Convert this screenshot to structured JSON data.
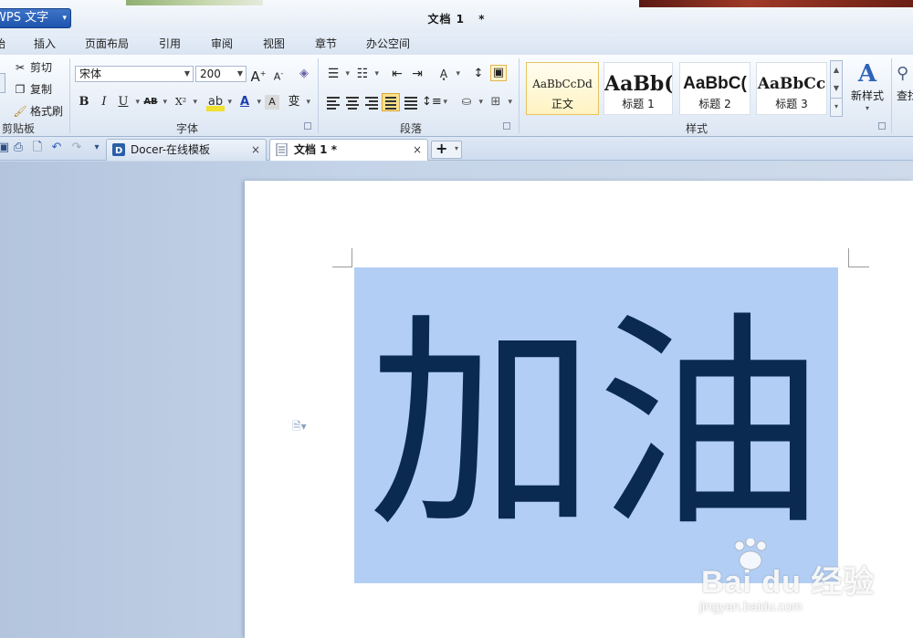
{
  "app": {
    "menu_button": "WPS 文字",
    "menu_arrow": "▾",
    "document_title": "文档 1",
    "modified_marker": "*"
  },
  "ribbon_tabs": [
    "始",
    "插入",
    "页面布局",
    "引用",
    "审阅",
    "视图",
    "章节",
    "办公空间"
  ],
  "clipboard": {
    "group_label": "剪贴板",
    "cut": "剪切",
    "copy": "复制",
    "format_painter": "格式刷"
  },
  "font": {
    "group_label": "字体",
    "font_name": "宋体",
    "font_size": "200",
    "bold": "B",
    "italic": "I",
    "underline": "U",
    "strikethrough": "AB",
    "superscript": "X²",
    "font_color": "A",
    "char_shading": "A",
    "phonetic": "变"
  },
  "paragraph": {
    "group_label": "段落"
  },
  "styles": {
    "group_label": "样式",
    "items": [
      {
        "sample": "AaBbCcDd",
        "name": "正文",
        "active": true
      },
      {
        "sample": "AaBb(",
        "name": "标题 1",
        "active": false
      },
      {
        "sample": "AaBbC(",
        "name": "标题 2",
        "active": false
      },
      {
        "sample": "AaBbCc",
        "name": "标题 3",
        "active": false
      }
    ],
    "new_style": "新样式",
    "find_replace": "查找"
  },
  "doc_tabs": [
    {
      "label": "Docer-在线模板",
      "close": "×",
      "active": false
    },
    {
      "label": "文档 1 *",
      "close": "×",
      "active": true
    }
  ],
  "new_tab": "+",
  "document": {
    "content": "加油"
  },
  "watermark": {
    "brand": "Bai du 经验",
    "url": "jingyan.baidu.com"
  },
  "colors": {
    "accent": "#1e54ad",
    "selection": "#b2cef4",
    "text": "#0b2a52"
  }
}
